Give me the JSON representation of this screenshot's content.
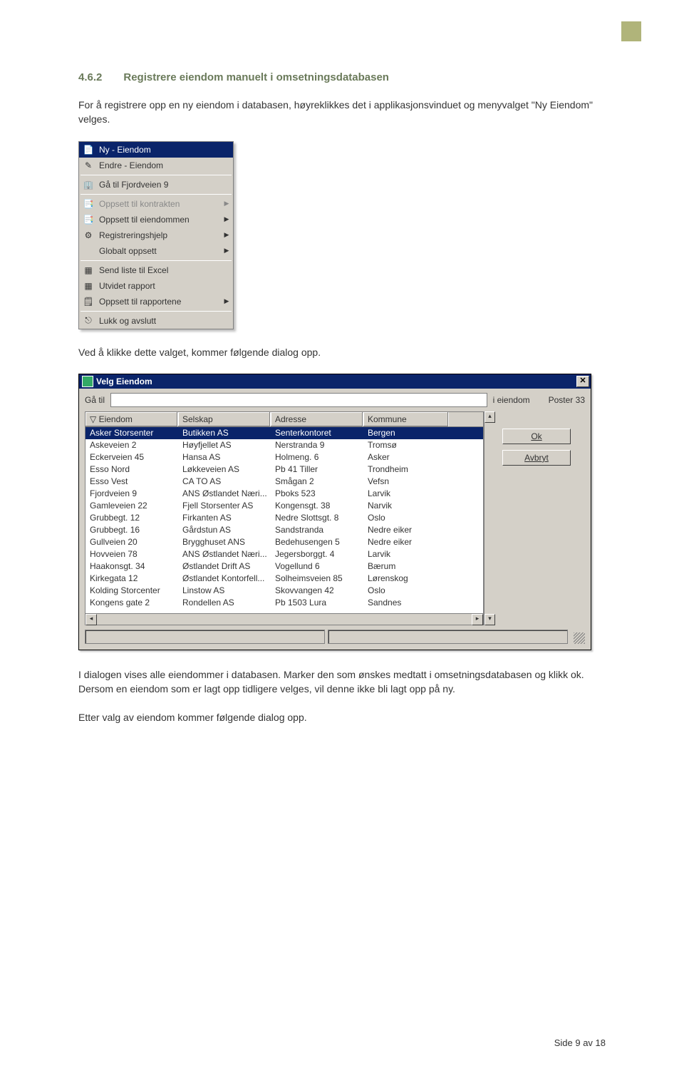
{
  "corner": {
    "color": "#b0b47a"
  },
  "section": {
    "number": "4.6.2",
    "title": "Registrere eiendom manuelt i omsetningsdatabasen"
  },
  "intro_text": "For å registrere opp en ny eiendom i databasen, høyreklikkes det i applikasjonsvinduet og menyvalget \"Ny Eiendom\" velges.",
  "context_menu": {
    "items": [
      {
        "label": "Ny - Eiendom",
        "icon": "page-icon",
        "selected": true,
        "arrow": false,
        "disabled": false
      },
      {
        "label": "Endre - Eiendom",
        "icon": "edit-icon",
        "selected": false,
        "arrow": false,
        "disabled": false
      },
      {
        "sep": true
      },
      {
        "label": "Gå til Fjordveien 9",
        "icon": "building-icon",
        "selected": false,
        "arrow": false,
        "disabled": false
      },
      {
        "sep": true
      },
      {
        "label": "Oppsett til kontrakten",
        "icon": "doc-icon",
        "selected": false,
        "arrow": true,
        "disabled": true
      },
      {
        "label": "Oppsett til eiendommen",
        "icon": "doc-icon",
        "selected": false,
        "arrow": true,
        "disabled": false
      },
      {
        "label": "Registreringshjelp",
        "icon": "gear-icon",
        "selected": false,
        "arrow": true,
        "disabled": false
      },
      {
        "label": "Globalt oppsett",
        "icon": "",
        "selected": false,
        "arrow": true,
        "disabled": false
      },
      {
        "sep": true
      },
      {
        "label": "Send liste til Excel",
        "icon": "excel-icon",
        "selected": false,
        "arrow": false,
        "disabled": false
      },
      {
        "label": "Utvidet rapport",
        "icon": "excel-icon",
        "selected": false,
        "arrow": false,
        "disabled": false
      },
      {
        "label": "Oppsett til rapportene",
        "icon": "report-icon",
        "selected": false,
        "arrow": true,
        "disabled": false
      },
      {
        "sep": true
      },
      {
        "label": "Lukk og avslutt",
        "icon": "exit-icon",
        "selected": false,
        "arrow": false,
        "disabled": false
      }
    ]
  },
  "mid_text": "Ved å klikke dette valget, kommer følgende dialog opp.",
  "dialog": {
    "title": "Velg Eiendom",
    "search": {
      "label": "Gå til",
      "value": "",
      "ie_label": "i eiendom",
      "poster_label": "Poster 33"
    },
    "columns": [
      "Eiendom",
      "Selskap",
      "Adresse",
      "Kommune"
    ],
    "rows": [
      {
        "c": [
          "Asker Storsenter",
          "Butikken AS",
          "Senterkontoret",
          "Bergen"
        ],
        "selected": true
      },
      {
        "c": [
          "Askeveien 2",
          "Høyfjellet AS",
          "Nerstranda 9",
          "Tromsø"
        ]
      },
      {
        "c": [
          "Eckerveien 45",
          "Hansa AS",
          "Holmeng. 6",
          "Asker"
        ]
      },
      {
        "c": [
          "Esso Nord",
          "Løkkeveien AS",
          "Pb 41 Tiller",
          "Trondheim"
        ]
      },
      {
        "c": [
          "Esso Vest",
          "CA TO AS",
          "Smågan 2",
          "Vefsn"
        ]
      },
      {
        "c": [
          "Fjordveien 9",
          "ANS Østlandet Næri...",
          "Pboks 523",
          "Larvik"
        ]
      },
      {
        "c": [
          "Gamleveien 22",
          "Fjell Storsenter AS",
          "Kongensgt. 38",
          "Narvik"
        ]
      },
      {
        "c": [
          "Grubbegt. 12",
          "Firkanten AS",
          "Nedre Slottsgt. 8",
          "Oslo"
        ]
      },
      {
        "c": [
          "Grubbegt. 16",
          "Gårdstun AS",
          "Sandstranda",
          "Nedre eiker"
        ]
      },
      {
        "c": [
          "Gullveien 20",
          "Brygghuset ANS",
          "Bedehusengen 5",
          "Nedre eiker"
        ]
      },
      {
        "c": [
          "Hovveien 78",
          "ANS Østlandet Næri...",
          "Jegersborggt. 4",
          "Larvik"
        ]
      },
      {
        "c": [
          "Haakonsgt. 34",
          "Østlandet Drift AS",
          "Vogellund 6",
          "Bærum"
        ]
      },
      {
        "c": [
          "Kirkegata 12",
          "Østlandet Kontorfell...",
          "Solheimsveien 85",
          "Lørenskog"
        ]
      },
      {
        "c": [
          "Kolding Storcenter",
          "Linstow AS",
          "Skovvangen 42",
          "Oslo"
        ]
      },
      {
        "c": [
          "Kongens gate 2",
          "Rondellen AS",
          "Pb 1503 Lura",
          "Sandnes"
        ]
      }
    ],
    "buttons": {
      "ok": "Ok",
      "cancel": "Avbryt"
    }
  },
  "after_dialog_text_1": "I dialogen vises alle eiendommer i databasen. Marker den som ønskes medtatt i omsetningsdatabasen og klikk ok. Dersom en eiendom som er lagt opp tidligere velges, vil denne ikke bli lagt opp på ny.",
  "after_dialog_text_2": "Etter valg av eiendom kommer følgende dialog opp.",
  "footer": {
    "page": "Side 9 av 18"
  }
}
